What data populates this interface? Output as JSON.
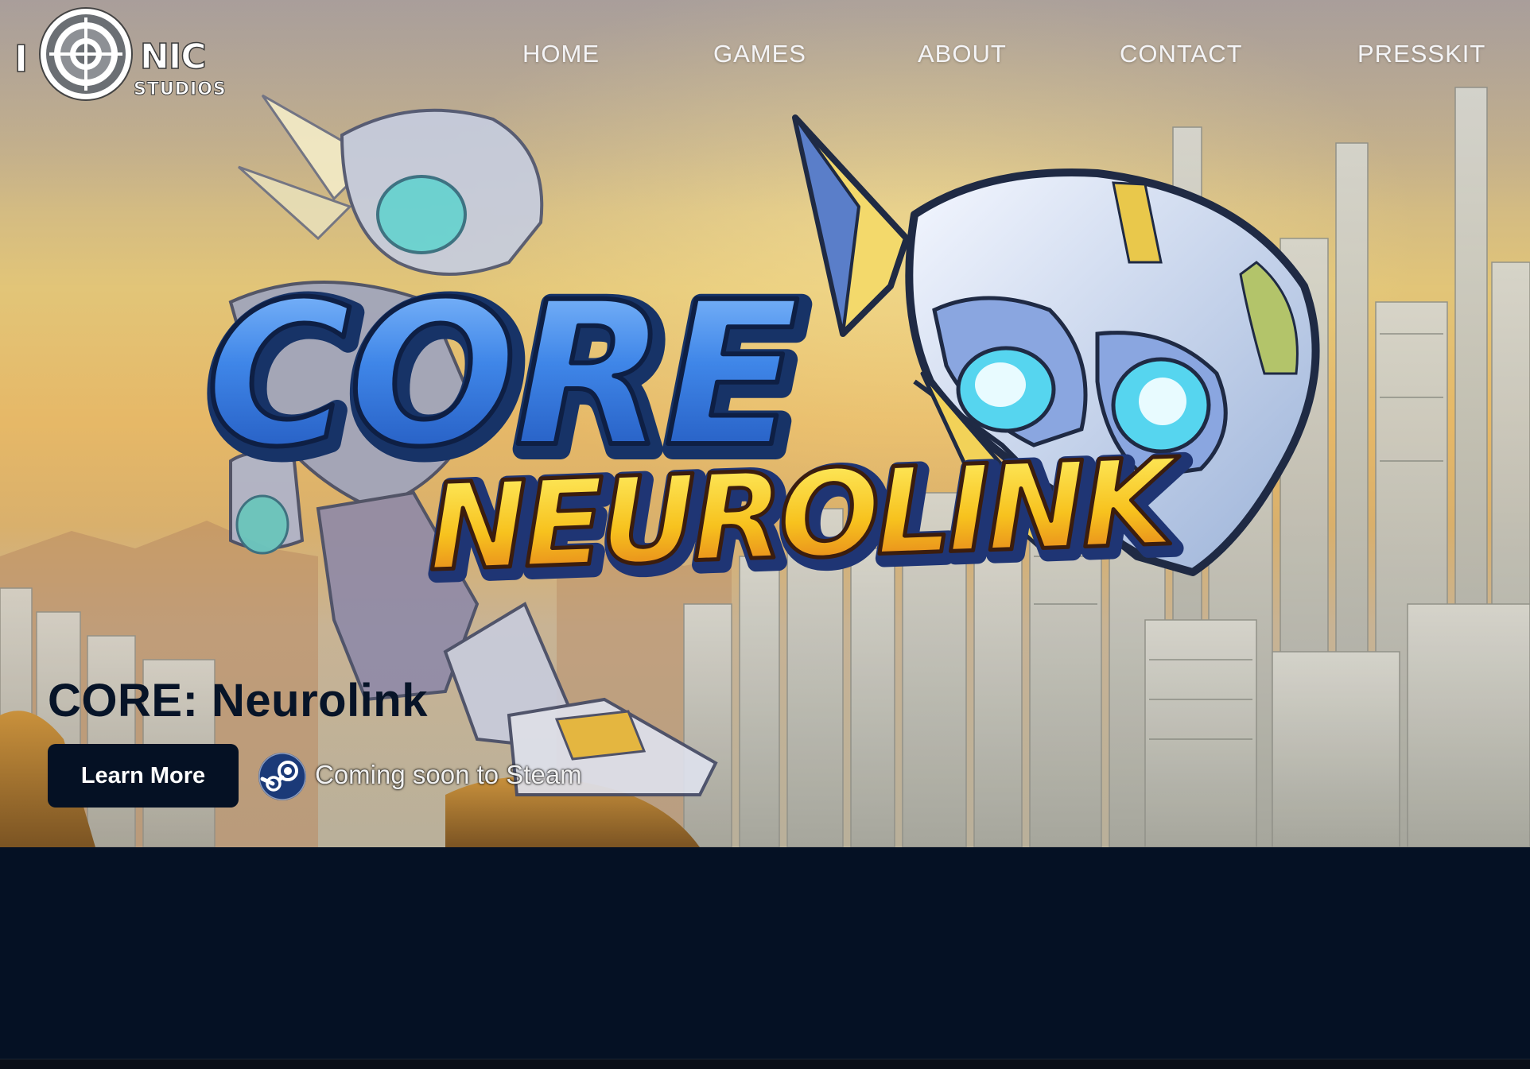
{
  "brand": {
    "logo_letter": "I",
    "logo_word": "NIC",
    "logo_sub": "STUDIOS"
  },
  "nav": {
    "items": [
      {
        "label": "HOME"
      },
      {
        "label": "GAMES"
      },
      {
        "label": "ABOUT"
      },
      {
        "label": "CONTACT"
      },
      {
        "label": "PRESSKIT"
      }
    ]
  },
  "hero": {
    "logo_word_1": "CORE",
    "logo_word_2": "NEUROLINK",
    "game_title": "CORE: Neurolink",
    "cta_label": "Learn More",
    "steam_icon": "steam-icon",
    "steam_text": "Coming soon to Steam"
  },
  "colors": {
    "dark_navy": "#051124",
    "nav_text": "#f4f4f6"
  }
}
